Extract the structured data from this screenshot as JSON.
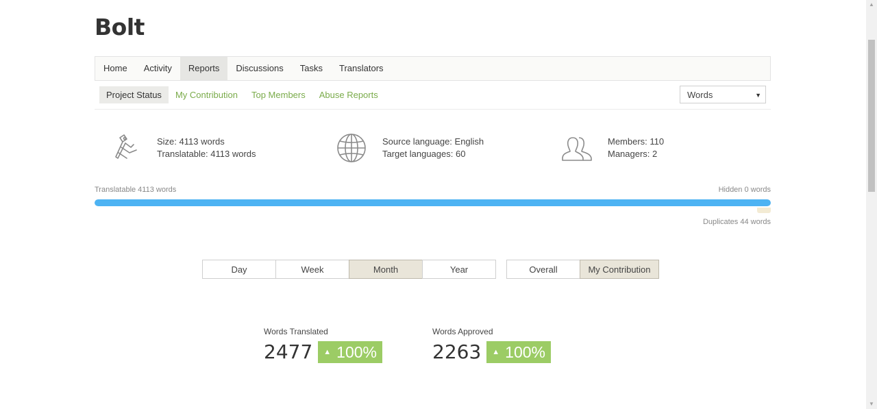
{
  "project": {
    "title": "Bolt"
  },
  "main_nav": [
    {
      "label": "Home",
      "active": false
    },
    {
      "label": "Activity",
      "active": false
    },
    {
      "label": "Reports",
      "active": true
    },
    {
      "label": "Discussions",
      "active": false
    },
    {
      "label": "Tasks",
      "active": false
    },
    {
      "label": "Translators",
      "active": false
    }
  ],
  "sub_nav": [
    {
      "label": "Project Status",
      "active": true
    },
    {
      "label": "My Contribution",
      "active": false
    },
    {
      "label": "Top Members",
      "active": false
    },
    {
      "label": "Abuse Reports",
      "active": false
    }
  ],
  "unit_select": {
    "value": "Words"
  },
  "stats": {
    "size": {
      "icon": "caliper-icon",
      "line1": "Size: 4113 words",
      "line2": "Translatable: 4113 words"
    },
    "languages": {
      "icon": "globe-icon",
      "line1": "Source language: English",
      "line2": "Target languages: 60"
    },
    "members": {
      "icon": "users-icon",
      "line1": "Members: 110",
      "line2": "Managers: 2"
    }
  },
  "progress": {
    "translatable_label": "Translatable 4113 words",
    "hidden_label": "Hidden 0 words",
    "duplicates_label": "Duplicates 44 words",
    "fill_fraction": 1.0
  },
  "period_options": [
    {
      "label": "Day",
      "active": false
    },
    {
      "label": "Week",
      "active": false
    },
    {
      "label": "Month",
      "active": true
    },
    {
      "label": "Year",
      "active": false
    }
  ],
  "scope_options": [
    {
      "label": "Overall",
      "active": false
    },
    {
      "label": "My Contribution",
      "active": true
    }
  ],
  "metrics": {
    "translated": {
      "label": "Words Translated",
      "value": "2477",
      "change": "100%"
    },
    "approved": {
      "label": "Words Approved",
      "value": "2263",
      "change": "100%"
    }
  },
  "colors": {
    "accent_green": "#7aab4a",
    "progress_blue": "#4db3f3",
    "badge_green": "#9ccc65"
  }
}
